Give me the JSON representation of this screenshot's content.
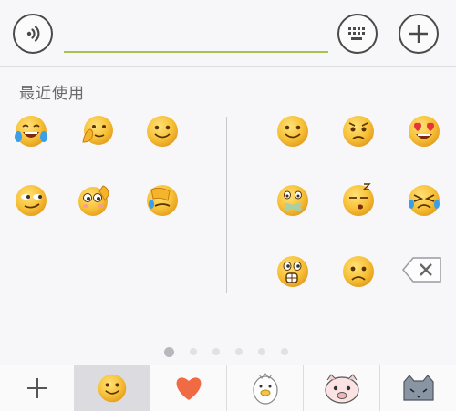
{
  "recent_section": {
    "label": "最近使用"
  },
  "emoji_grid": {
    "left_column": [
      {
        "icon": "tears-of-joy-emoji"
      },
      {
        "icon": "thinking-hand-emoji"
      },
      {
        "icon": "smile-emoji"
      },
      {
        "icon": "smirk-emoji"
      },
      {
        "icon": "salute-emoji"
      },
      {
        "icon": "facepalm-emoji"
      }
    ],
    "right_column": [
      {
        "icon": "smile-emoji"
      },
      {
        "icon": "worried-emoji"
      },
      {
        "icon": "heart-eyes-emoji"
      },
      {
        "icon": "shut-mouth-emoji"
      },
      {
        "icon": "sleepy-emoji"
      },
      {
        "icon": "crying-angry-emoji"
      },
      {
        "icon": "shocked-emoji"
      },
      {
        "icon": "frown-emoji"
      }
    ]
  },
  "pager": {
    "pages": 6,
    "current": 1
  },
  "bottom_tabs": [
    {
      "icon": "add-icon",
      "selected": false
    },
    {
      "icon": "smiley-tab-icon",
      "selected": true
    },
    {
      "icon": "heart-tab-icon",
      "selected": false
    },
    {
      "icon": "duck-sticker-icon",
      "selected": false
    },
    {
      "icon": "pig-sticker-icon",
      "selected": false
    },
    {
      "icon": "cat-sticker-icon",
      "selected": false
    }
  ],
  "colors": {
    "accent_line": "#a6c24f",
    "emoji_yellow": "#f7c138",
    "heart_red": "#f06a44"
  }
}
